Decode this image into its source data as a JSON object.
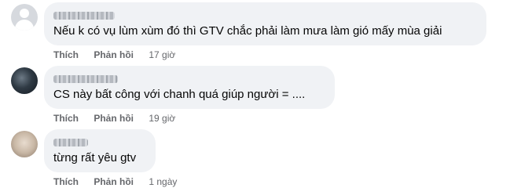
{
  "comments": [
    {
      "text": "Nếu k có vụ lùm xùm đó thì GTV chắc phải làm mưa làm gió mấy mùa giải",
      "like_label": "Thích",
      "reply_label": "Phản hồi",
      "time": "17 giờ"
    },
    {
      "text": "CS này bất công với chanh quá giúp người = ....",
      "like_label": "Thích",
      "reply_label": "Phản hồi",
      "time": "19 giờ"
    },
    {
      "text": "từng rất yêu gtv",
      "like_label": "Thích",
      "reply_label": "Phản hồi",
      "time": "1 ngày"
    }
  ],
  "colors": {
    "bubble": "#f0f2f5",
    "text": "#050505",
    "secondary": "#65676b"
  }
}
